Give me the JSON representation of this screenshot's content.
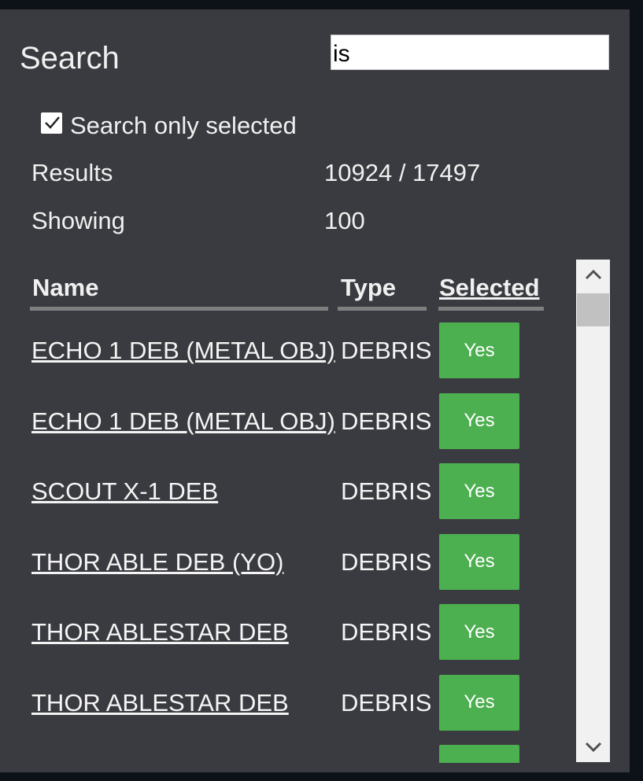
{
  "search": {
    "label": "Search",
    "value": "is"
  },
  "filter": {
    "only_selected_label": "Search only selected",
    "only_selected_checked": true
  },
  "stats": {
    "results_label": "Results",
    "results_value": "10924 / 17497",
    "showing_label": "Showing",
    "showing_value": "100"
  },
  "table": {
    "columns": {
      "name": "Name",
      "type": "Type",
      "selected": "Selected"
    },
    "rows": [
      {
        "name": "ECHO 1 DEB (METAL OBJ)",
        "type": "DEBRIS",
        "selected": "Yes"
      },
      {
        "name": "ECHO 1 DEB (METAL OBJ)",
        "type": "DEBRIS",
        "selected": "Yes"
      },
      {
        "name": "SCOUT X-1 DEB",
        "type": "DEBRIS",
        "selected": "Yes"
      },
      {
        "name": "THOR ABLE DEB (YO)",
        "type": "DEBRIS",
        "selected": "Yes"
      },
      {
        "name": "THOR ABLESTAR DEB",
        "type": "DEBRIS",
        "selected": "Yes"
      },
      {
        "name": "THOR ABLESTAR DEB",
        "type": "DEBRIS",
        "selected": "Yes"
      },
      {
        "name": "",
        "type": "",
        "selected": ""
      }
    ]
  },
  "colors": {
    "panel_bg": "#3a3b40",
    "accent_green": "#4caf50",
    "text": "#f0f0f0"
  },
  "icons": {
    "checkbox": "check-icon",
    "scroll_up": "chevron-up-icon",
    "scroll_down": "chevron-down-icon"
  }
}
